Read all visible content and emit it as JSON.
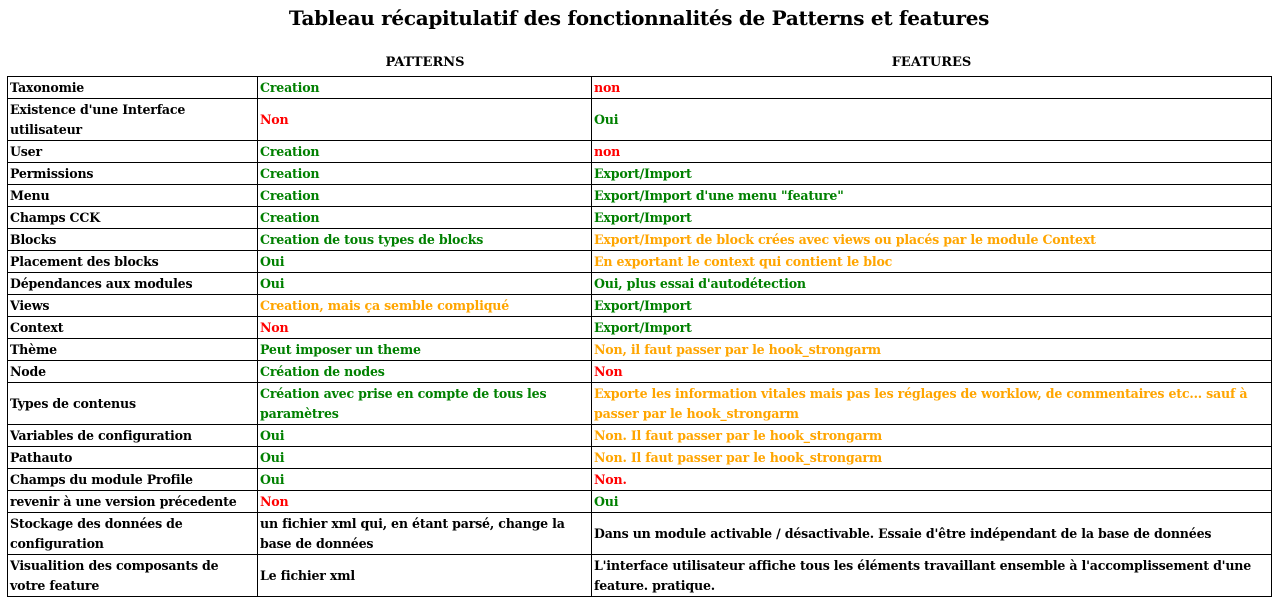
{
  "title": "Tableau récapitulatif des fonctionnalités de Patterns et features",
  "headers": {
    "patterns": "PATTERNS",
    "features": "FEATURES"
  },
  "colors": {
    "green": "#008000",
    "red": "#ff0000",
    "orange": "#ffa500",
    "black": "#000000"
  },
  "rows": [
    {
      "label": "Taxonomie",
      "patterns": {
        "text": "Creation",
        "color": "green"
      },
      "features": {
        "text": "non",
        "color": "red"
      }
    },
    {
      "label": "Existence d'une Interface utilisateur",
      "patterns": {
        "text": "Non",
        "color": "red"
      },
      "features": {
        "text": "Oui",
        "color": "green"
      }
    },
    {
      "label": "User",
      "patterns": {
        "text": "Creation",
        "color": "green"
      },
      "features": {
        "text": "non",
        "color": "red"
      }
    },
    {
      "label": "Permissions",
      "patterns": {
        "text": "Creation",
        "color": "green"
      },
      "features": {
        "text": "Export/Import",
        "color": "green"
      }
    },
    {
      "label": "Menu",
      "patterns": {
        "text": "Creation",
        "color": "green"
      },
      "features": {
        "text": "Export/Import d'une menu \"feature\"",
        "color": "green"
      }
    },
    {
      "label": "Champs CCK",
      "patterns": {
        "text": "Creation",
        "color": "green"
      },
      "features": {
        "text": "Export/Import",
        "color": "green"
      }
    },
    {
      "label": "Blocks",
      "patterns": {
        "text": "Creation de tous types de blocks",
        "color": "green"
      },
      "features": {
        "text": "Export/Import de block crées avec views ou placés par le module Context",
        "color": "orange"
      }
    },
    {
      "label": "Placement des blocks",
      "patterns": {
        "text": "Oui",
        "color": "green"
      },
      "features": {
        "text": "En exportant le context qui contient le bloc",
        "color": "orange"
      }
    },
    {
      "label": "Dépendances aux modules",
      "patterns": {
        "text": "Oui",
        "color": "green"
      },
      "features": {
        "text": "Oui, plus essai d'autodétection",
        "color": "green"
      }
    },
    {
      "label": "Views",
      "patterns": {
        "text": "Creation, mais ça semble compliqué",
        "color": "orange"
      },
      "features": {
        "text": "Export/Import",
        "color": "green"
      }
    },
    {
      "label": "Context",
      "patterns": {
        "text": "Non",
        "color": "red"
      },
      "features": {
        "text": "Export/Import",
        "color": "green"
      }
    },
    {
      "label": "Thème",
      "patterns": {
        "text": "Peut imposer un theme",
        "color": "green"
      },
      "features": {
        "text": "Non, il faut passer par le hook_strongarm",
        "color": "orange"
      }
    },
    {
      "label": "Node",
      "patterns": {
        "text": "Création de nodes",
        "color": "green"
      },
      "features": {
        "text": "Non",
        "color": "red"
      }
    },
    {
      "label": "Types de contenus",
      "patterns": {
        "text": "Création avec prise en compte de tous les paramètres",
        "color": "green"
      },
      "features": {
        "text": "Exporte les information vitales mais pas les réglages de worklow, de commentaires etc... sauf à passer par le hook_strongarm",
        "color": "orange"
      },
      "tall": true
    },
    {
      "label": "Variables de configuration",
      "patterns": {
        "text": "Oui",
        "color": "green"
      },
      "features": {
        "text": "Non. Il faut passer par le hook_strongarm",
        "color": "orange"
      }
    },
    {
      "label": "Pathauto",
      "patterns": {
        "text": "Oui",
        "color": "green"
      },
      "features": {
        "text": "Non. Il faut passer par le hook_strongarm",
        "color": "orange"
      }
    },
    {
      "label": "Champs du module Profile",
      "patterns": {
        "text": "Oui",
        "color": "green"
      },
      "features": {
        "text": "Non.",
        "color": "red"
      }
    },
    {
      "label": "revenir à une version précedente",
      "patterns": {
        "text": "Non",
        "color": "red"
      },
      "features": {
        "text": "Oui",
        "color": "green"
      }
    },
    {
      "label": "Stockage des données de configuration",
      "patterns": {
        "text": "un fichier xml qui, en étant parsé, change la base de données",
        "color": "black"
      },
      "features": {
        "text": "Dans un module activable / désactivable. Essaie d'être indépendant de la base de données",
        "color": "black"
      },
      "tall": true
    },
    {
      "label": "Visualition des composants de votre feature",
      "patterns": {
        "text": "Le fichier xml",
        "color": "black"
      },
      "features": {
        "text": "L'interface utilisateur affiche tous les éléments travaillant ensemble à l'accomplissement d'une feature. pratique.",
        "color": "black"
      },
      "tall": true
    }
  ]
}
